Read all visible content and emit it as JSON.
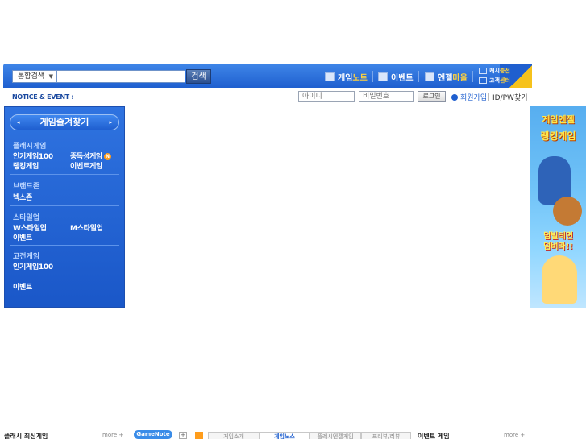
{
  "search": {
    "select_label": "통합검색",
    "input_value": "",
    "button_label": "검색"
  },
  "nav": {
    "gamenote_pre": "게임",
    "gamenote_hl": "노트",
    "event": "이벤트",
    "village_pre": "엔젤",
    "village_hl": "마을",
    "cash_pre": "캐시",
    "cash_hl": "충전",
    "cs_pre": "고객",
    "cs_hl": "센터"
  },
  "notice": {
    "label": "NOTICE & EVENT :"
  },
  "login": {
    "id_placeholder": "아이디",
    "pw_placeholder": "비밀번호",
    "login_button": "로그인",
    "signup": "회원가입",
    "find": "ID/PW찾기"
  },
  "menu": {
    "favorite": "게임즐겨찾기",
    "sections": [
      {
        "title": "플래시게임",
        "items": [
          "인기게임100",
          "중독성게임",
          "랭킹게임",
          "이벤트게임"
        ]
      },
      {
        "title": "브랜드존",
        "items": [
          "넥스존"
        ]
      },
      {
        "title": "스타일업",
        "items": [
          "W스타일업",
          "M스타일업",
          "이벤트"
        ]
      },
      {
        "title": "고전게임",
        "items": [
          "인기게임100"
        ]
      },
      {
        "title": "이벤트",
        "items": []
      }
    ],
    "new_badge": "N"
  },
  "banner": {
    "line1": "게임엔젤",
    "line2": "랭킹게임",
    "line3": "덤빌테면",
    "line4": "덤벼라!!"
  },
  "bottom": {
    "left_title": "플래시 최신게임",
    "more1": "more +",
    "gamenote": "GameNote",
    "plus": "+",
    "tabs": [
      "게임소개",
      "게임노스",
      "플레시엔젤게임",
      "프리뷰/리뷰"
    ],
    "right_title": "이벤트 게임",
    "more2": "more +"
  }
}
